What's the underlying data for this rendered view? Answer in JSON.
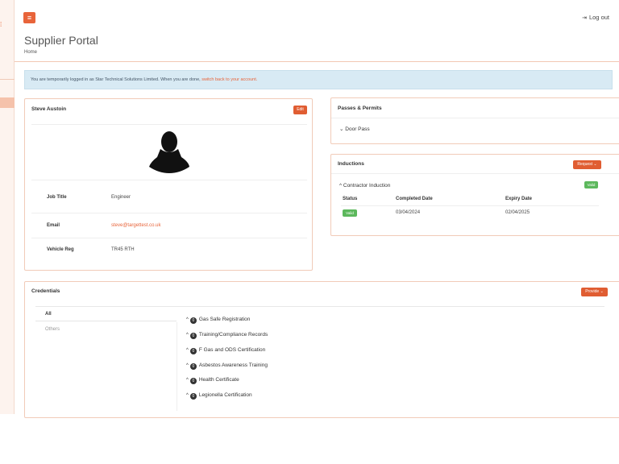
{
  "header": {
    "menu_icon": "hamburger-icon",
    "logout_icon": "sign-out-icon",
    "logout_label": "Log out"
  },
  "page": {
    "title": "Supplier Portal",
    "breadcrumb": "Home"
  },
  "alert": {
    "text": "You are temporarily logged in as Star Technical Solutions Limited. When you are done, ",
    "link": "switch back to your account."
  },
  "profile": {
    "name": "Steve Austoin",
    "edit_label": "Edit",
    "avatar_icon": "user-silhouette-icon",
    "fields": [
      {
        "label": "Job Title",
        "value": "Engineer"
      },
      {
        "label": "Email",
        "value": "steve@targettest.co.uk"
      },
      {
        "label": "Vehicle Reg",
        "value": "TR45 RTH"
      }
    ]
  },
  "passes": {
    "title": "Passes & Permits",
    "door_pass": "Door Pass"
  },
  "inductions": {
    "title": "Inductions",
    "request_label": "Request",
    "item": {
      "name": "Contractor Induction",
      "badge": "Valid",
      "columns": [
        "Status",
        "Completed Date",
        "Expiry Date"
      ],
      "row": {
        "status": "Valid",
        "completed": "03/04/2024",
        "expiry": "02/04/2025"
      }
    }
  },
  "credentials": {
    "title": "Credentials",
    "provide_label": "Provide",
    "tabs": [
      "All",
      "Others"
    ],
    "items": [
      {
        "count": "0",
        "name": "Gas Safe Registration"
      },
      {
        "count": "0",
        "name": "Training/Compliance Records"
      },
      {
        "count": "0",
        "name": "F Gas and ODS Certification"
      },
      {
        "count": "0",
        "name": "Asbestos Awareness Training"
      },
      {
        "count": "0",
        "name": "Health Certificate"
      },
      {
        "count": "0",
        "name": "Legionella Certification"
      }
    ]
  },
  "colors": {
    "accent": "#e05d32",
    "valid": "#5cb85c",
    "alert_bg": "#d8eaf4"
  }
}
